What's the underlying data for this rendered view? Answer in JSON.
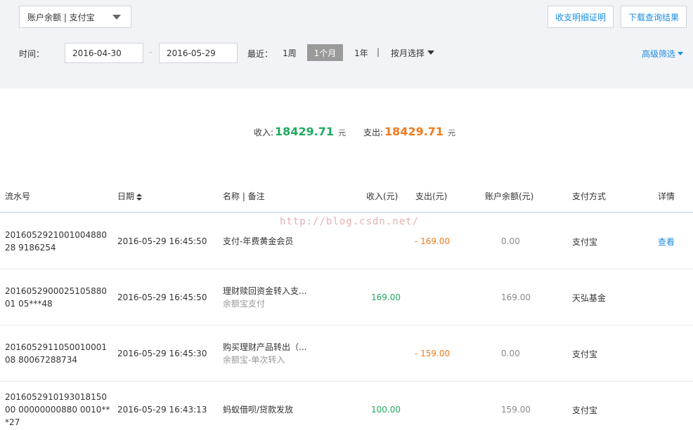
{
  "filters": {
    "account_select": "账户余额 | 支付宝",
    "proof_button": "收支明细证明",
    "download_button": "下载查询结果",
    "time_label": "时间：",
    "date_start": "2016-04-30",
    "date_sep": "-",
    "date_end": "2016-05-29",
    "recent_label": "最近：",
    "range_options": [
      "1周",
      "1个月",
      "1年"
    ],
    "selected_range": "1个月",
    "divider": "|",
    "by_month": "按月选择",
    "advanced_filter": "高级筛选"
  },
  "summary": {
    "income_label": "收入:",
    "income_amount": "18429.71",
    "income_unit": "元",
    "expense_label": "支出:",
    "expense_amount": "18429.71",
    "expense_unit": "元"
  },
  "table": {
    "headers": {
      "serial": "流水号",
      "date": "日期",
      "name": "名称 | 备注",
      "income": "收入(元)",
      "expense": "支出(元)",
      "balance": "账户余额(元)",
      "method": "支付方式",
      "detail": "详情"
    },
    "rows": [
      {
        "serial": "201605292100100488028 9186254",
        "date": "2016-05-29 16:45:50",
        "name": "支付-年费黄金会员",
        "note": "",
        "income": "",
        "expense": "- 169.00",
        "balance": "0.00",
        "method": "支付宝",
        "detail": "查看"
      },
      {
        "serial": "201605290002510588001 05***48",
        "date": "2016-05-29 16:45:50",
        "name": "理财赎回资金转入支...",
        "note": "余额宝支付",
        "income": "169.00",
        "expense": "",
        "balance": "169.00",
        "method": "天弘基金",
        "detail": ""
      },
      {
        "serial": "201605291105001000108 80067288734",
        "date": "2016-05-29 16:45:30",
        "name": "购买理财产品转出（...",
        "note": "余额宝-单次转入",
        "income": "",
        "expense": "- 159.00",
        "balance": "0.00",
        "method": "支付宝",
        "detail": ""
      },
      {
        "serial": "201605291019301815000 00000000880 0010***27",
        "date": "2016-05-29 16:43:13",
        "name": "蚂蚁借呗/贷款发放",
        "note": "",
        "income": "100.00",
        "expense": "",
        "balance": "159.00",
        "method": "支付宝",
        "detail": ""
      }
    ]
  },
  "watermark": "http://blog.csdn.net/"
}
